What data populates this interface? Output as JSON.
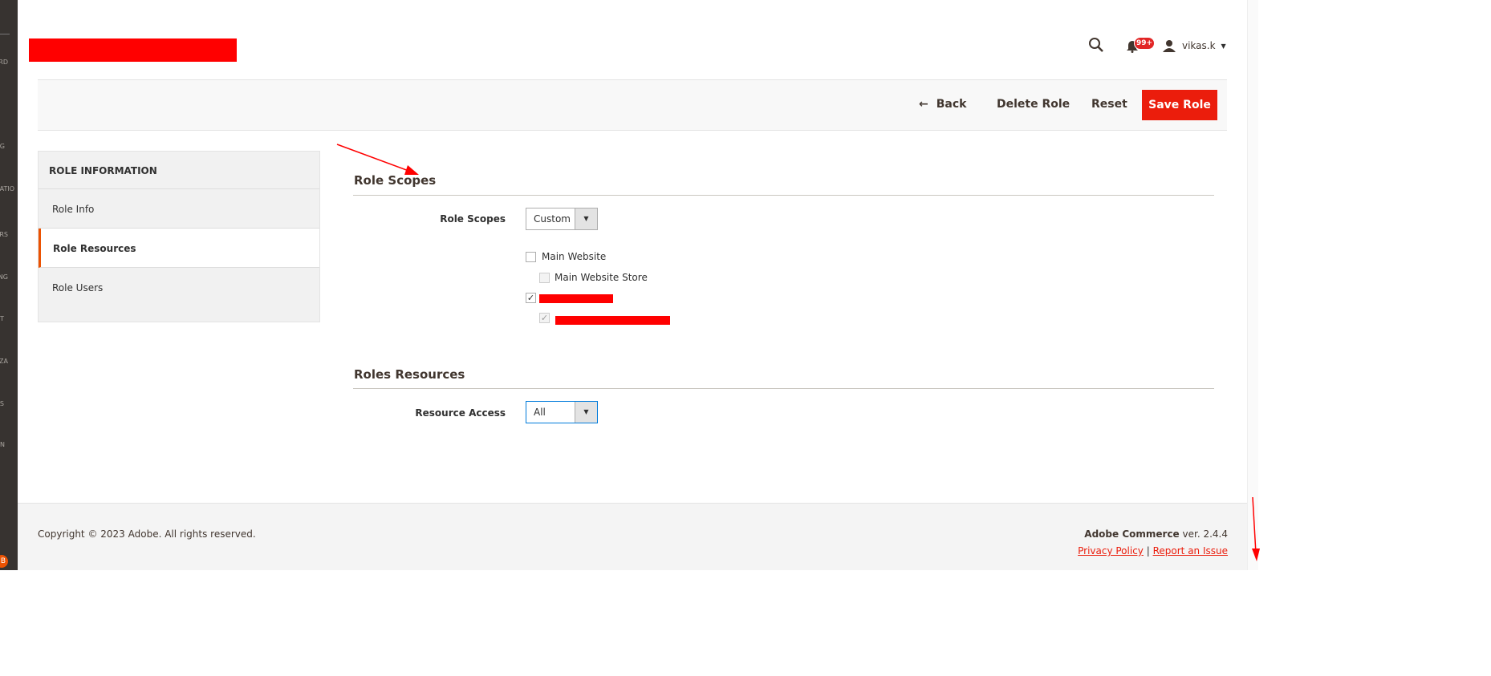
{
  "sidebar": {
    "items": [
      "RD",
      "G",
      "ATIO",
      "RS",
      "NG",
      "T",
      "ZA",
      "S",
      "N",
      "."
    ],
    "badge": "B"
  },
  "header": {
    "notification_count": "99+",
    "user": "vikas.k"
  },
  "toolbar": {
    "back": "Back",
    "delete": "Delete Role",
    "reset": "Reset",
    "save": "Save Role"
  },
  "tabs": {
    "title": "ROLE INFORMATION",
    "items": [
      "Role Info",
      "Role Resources",
      "Role Users"
    ]
  },
  "scopes": {
    "section_title": "Role Scopes",
    "label": "Role Scopes",
    "value": "Custom",
    "options": [
      {
        "label": "Main Website",
        "checked": false
      },
      {
        "label": "Main Website Store",
        "checked": false,
        "disabled": true
      }
    ]
  },
  "resources": {
    "section_title": "Roles Resources",
    "label": "Resource Access",
    "value": "All"
  },
  "footer": {
    "copyright": "Copyright © 2023 Adobe. All rights reserved.",
    "product": "Adobe Commerce",
    "version": " ver. 2.4.4",
    "privacy": "Privacy Policy",
    "separator": "|",
    "report": "Report an Issue"
  },
  "colors": {
    "accent": "#eb1d0c",
    "active_tab": "#eb5202",
    "sidebar": "#373330"
  }
}
